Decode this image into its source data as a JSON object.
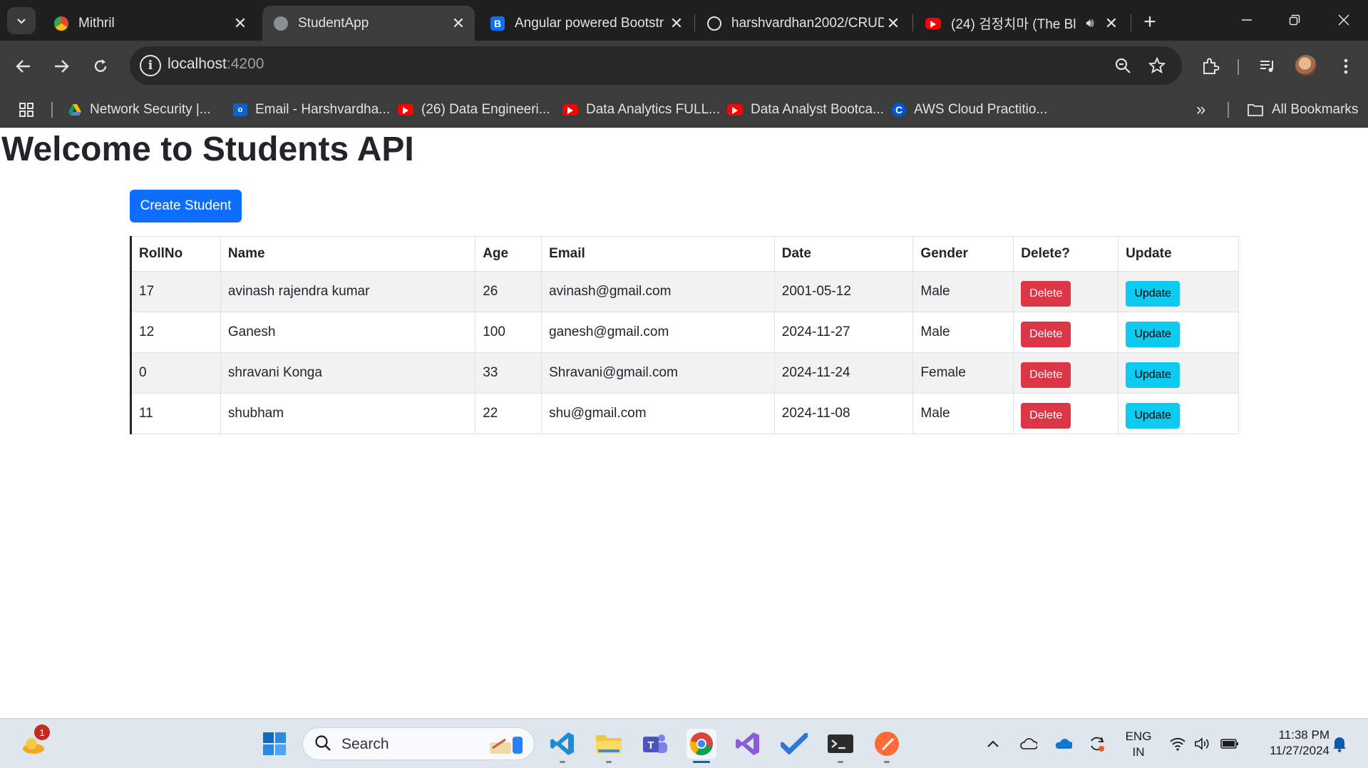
{
  "browser": {
    "tabs": [
      {
        "title": "Mithril",
        "close": "✕",
        "active": false
      },
      {
        "title": "StudentApp",
        "close": "✕",
        "active": true
      },
      {
        "title": "Angular powered Bootstr",
        "close": "✕",
        "active": false,
        "favicon_letter": "B"
      },
      {
        "title": "harshvardhan2002/CRUD",
        "close": "✕",
        "active": false
      },
      {
        "title": "(24) 검정치마 (The Bl",
        "close": "✕",
        "active": false
      }
    ],
    "new_tab": "+",
    "url_host": "localhost",
    "url_port": ":4200",
    "bookmarks": [
      {
        "label": "Network Security |...",
        "icon": "gdrive-icon"
      },
      {
        "label": "Email - Harshvardha...",
        "icon": "outlook-icon"
      },
      {
        "label": "(26) Data Engineeri...",
        "icon": "youtube-icon"
      },
      {
        "label": "Data Analytics FULL...",
        "icon": "youtube-icon"
      },
      {
        "label": "Data Analyst Bootca...",
        "icon": "youtube-icon"
      },
      {
        "label": "AWS Cloud Practitio...",
        "icon": "coursera-icon"
      }
    ],
    "more_bookmarks": "»",
    "all_bookmarks": "All Bookmarks"
  },
  "page": {
    "title": "Welcome to Students API",
    "create_button": "Create Student",
    "columns": [
      "RollNo",
      "Name",
      "Age",
      "Email",
      "Date",
      "Gender",
      "Delete?",
      "Update"
    ],
    "rows": [
      {
        "rollno": "17",
        "name": "avinash rajendra kumar",
        "age": "26",
        "email": "avinash@gmail.com",
        "date": "2001-05-12",
        "gender": "Male"
      },
      {
        "rollno": "12",
        "name": "Ganesh",
        "age": "100",
        "email": "ganesh@gmail.com",
        "date": "2024-11-27",
        "gender": "Male"
      },
      {
        "rollno": "0",
        "name": "shravani Konga",
        "age": "33",
        "email": "Shravani@gmail.com",
        "date": "2024-11-24",
        "gender": "Female"
      },
      {
        "rollno": "11",
        "name": "shubham",
        "age": "22",
        "email": "shu@gmail.com",
        "date": "2024-11-08",
        "gender": "Male"
      }
    ],
    "delete_label": "Delete",
    "update_label": "Update"
  },
  "taskbar": {
    "search_label": "Search",
    "notification_count": "1",
    "language_line1": "ENG",
    "language_line2": "IN",
    "time": "11:38 PM",
    "date": "11/27/2024"
  },
  "colors": {
    "primary": "#0d6efd",
    "danger": "#dc3545",
    "info": "#0dcaf0",
    "chrome_dark": "#1f1f1f",
    "chrome_toolbar": "#3c3c3c"
  }
}
